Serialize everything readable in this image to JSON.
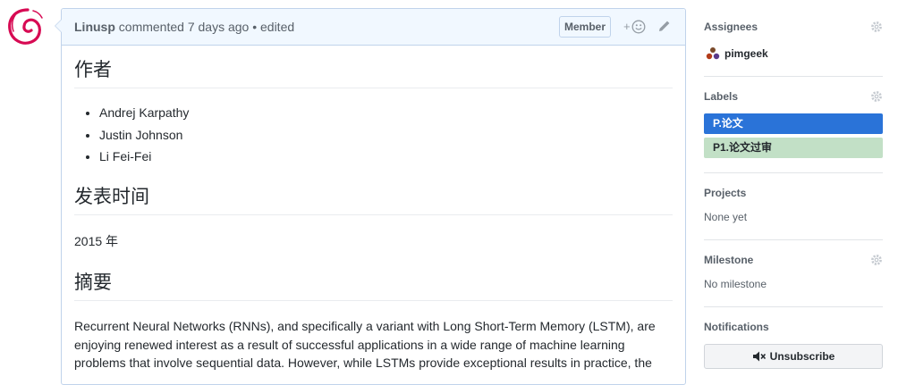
{
  "comment": {
    "author": "Linusp",
    "meta": "commented 7 days ago • edited",
    "badge": "Member",
    "reaction_plus": "+"
  },
  "body": {
    "h_authors": "作者",
    "authors": [
      "Andrej Karpathy",
      "Justin Johnson",
      "Li Fei-Fei"
    ],
    "h_published": "发表时间",
    "published": "2015 年",
    "h_abstract": "摘要",
    "abstract": "Recurrent Neural Networks (RNNs), and specifically a variant with Long Short-Term Memory (LSTM), are enjoying renewed interest as a result of successful applications in a wide range of machine learning problems that involve sequential data. However, while LSTMs provide exceptional results in practice, the"
  },
  "sidebar": {
    "assignees": {
      "title": "Assignees",
      "name": "pimgeek"
    },
    "labels": {
      "title": "Labels",
      "items": [
        {
          "text": "P.论文",
          "bg": "#2a73d8",
          "fg": "#ffffff"
        },
        {
          "text": "P1.论文过审",
          "bg": "#c2e0c6",
          "fg": "#24292e"
        }
      ]
    },
    "projects": {
      "title": "Projects",
      "value": "None yet"
    },
    "milestone": {
      "title": "Milestone",
      "value": "No milestone"
    },
    "notifications": {
      "title": "Notifications",
      "button": "Unsubscribe"
    }
  },
  "colors": {
    "header_bg": "#f1f8ff",
    "border": "#c0d3eb",
    "logo": "#d70a53"
  },
  "icons": [
    "debian-swirl-avatar",
    "smiley-icon",
    "pencil-icon",
    "gear-icon",
    "mute-icon",
    "assignee-avatar"
  ]
}
